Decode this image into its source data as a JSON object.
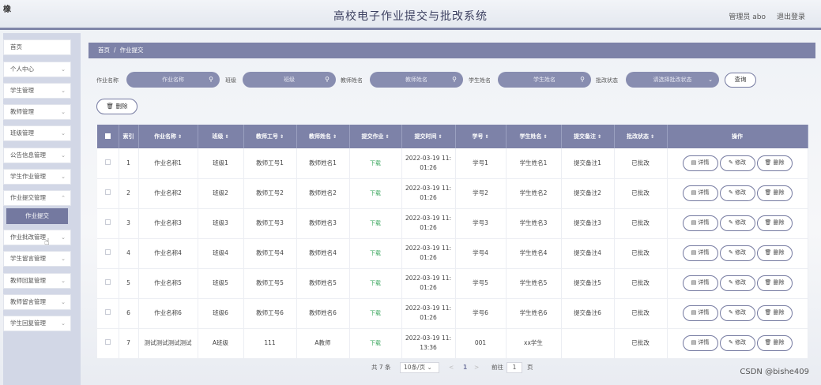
{
  "header": {
    "logo": "橡",
    "title": "高校电子作业提交与批改系统",
    "admin_label": "管理员 abo",
    "logout_label": "退出登录"
  },
  "sidebar": {
    "items": [
      {
        "label": "首页"
      },
      {
        "label": "个人中心"
      },
      {
        "label": "学生管理"
      },
      {
        "label": "教师管理"
      },
      {
        "label": "班级管理"
      },
      {
        "label": "公告信息管理"
      },
      {
        "label": "学生作业管理"
      },
      {
        "label": "作业提交管理"
      },
      {
        "label": "作业批改管理"
      },
      {
        "label": "学生留言管理"
      },
      {
        "label": "教师回复管理"
      },
      {
        "label": "教师留言管理"
      },
      {
        "label": "学生回复管理"
      }
    ],
    "active_sub": "作业提交"
  },
  "breadcrumb": {
    "home": "首页",
    "sep": "/",
    "current": "作业提交"
  },
  "search": {
    "homework_label": "作业名称",
    "homework_placeholder": "作业名称",
    "class_label": "班级",
    "class_placeholder": "班级",
    "teacher_label": "教师姓名",
    "teacher_placeholder": "教师姓名",
    "student_label": "学生姓名",
    "student_placeholder": "学生姓名",
    "status_label": "批改状态",
    "status_placeholder": "请选择批改状态",
    "query_label": "查询"
  },
  "toolbar": {
    "delete_label": "删除"
  },
  "table": {
    "columns": [
      "索引",
      "作业名称",
      "班级",
      "教师工号",
      "教师姓名",
      "提交作业",
      "提交时间",
      "学号",
      "学生姓名",
      "提交备注",
      "批改状态",
      "操作"
    ],
    "download_label": "下载",
    "detail_label": "详情",
    "edit_label": "修改",
    "delete_label": "删除",
    "rows": [
      {
        "idx": "1",
        "name": "作业名称1",
        "cls": "班级1",
        "tid": "教师工号1",
        "tname": "教师姓名1",
        "time1": "2022-03-19 11:",
        "time2": "01:26",
        "sid": "学号1",
        "sname": "学生姓名1",
        "note": "提交备注1",
        "status": "已批改"
      },
      {
        "idx": "2",
        "name": "作业名称2",
        "cls": "班级2",
        "tid": "教师工号2",
        "tname": "教师姓名2",
        "time1": "2022-03-19 11:",
        "time2": "01:26",
        "sid": "学号2",
        "sname": "学生姓名2",
        "note": "提交备注2",
        "status": "已批改"
      },
      {
        "idx": "3",
        "name": "作业名称3",
        "cls": "班级3",
        "tid": "教师工号3",
        "tname": "教师姓名3",
        "time1": "2022-03-19 11:",
        "time2": "01:26",
        "sid": "学号3",
        "sname": "学生姓名3",
        "note": "提交备注3",
        "status": "已批改"
      },
      {
        "idx": "4",
        "name": "作业名称4",
        "cls": "班级4",
        "tid": "教师工号4",
        "tname": "教师姓名4",
        "time1": "2022-03-19 11:",
        "time2": "01:26",
        "sid": "学号4",
        "sname": "学生姓名4",
        "note": "提交备注4",
        "status": "已批改"
      },
      {
        "idx": "5",
        "name": "作业名称5",
        "cls": "班级5",
        "tid": "教师工号5",
        "tname": "教师姓名5",
        "time1": "2022-03-19 11:",
        "time2": "01:26",
        "sid": "学号5",
        "sname": "学生姓名5",
        "note": "提交备注5",
        "status": "已批改"
      },
      {
        "idx": "6",
        "name": "作业名称6",
        "cls": "班级6",
        "tid": "教师工号6",
        "tname": "教师姓名6",
        "time1": "2022-03-19 11:",
        "time2": "01:26",
        "sid": "学号6",
        "sname": "学生姓名6",
        "note": "提交备注6",
        "status": "已批改"
      },
      {
        "idx": "7",
        "name": "测试测试测试测试",
        "cls": "A班级",
        "tid": "111",
        "tname": "A教师",
        "time1": "2022-03-19 11:",
        "time2": "13:36",
        "sid": "001",
        "sname": "xx学生",
        "note": "",
        "status": "已批改"
      }
    ]
  },
  "pagination": {
    "total": "共 7 条",
    "page_size": "10条/页",
    "prev": "<",
    "current": "1",
    "next": ">",
    "goto_label": "前往",
    "goto_value": "1",
    "page_suffix": "页"
  },
  "watermark": "CSDN @bishe409",
  "colors": {
    "accent": "#7d82a8",
    "download": "#3aa55d"
  }
}
